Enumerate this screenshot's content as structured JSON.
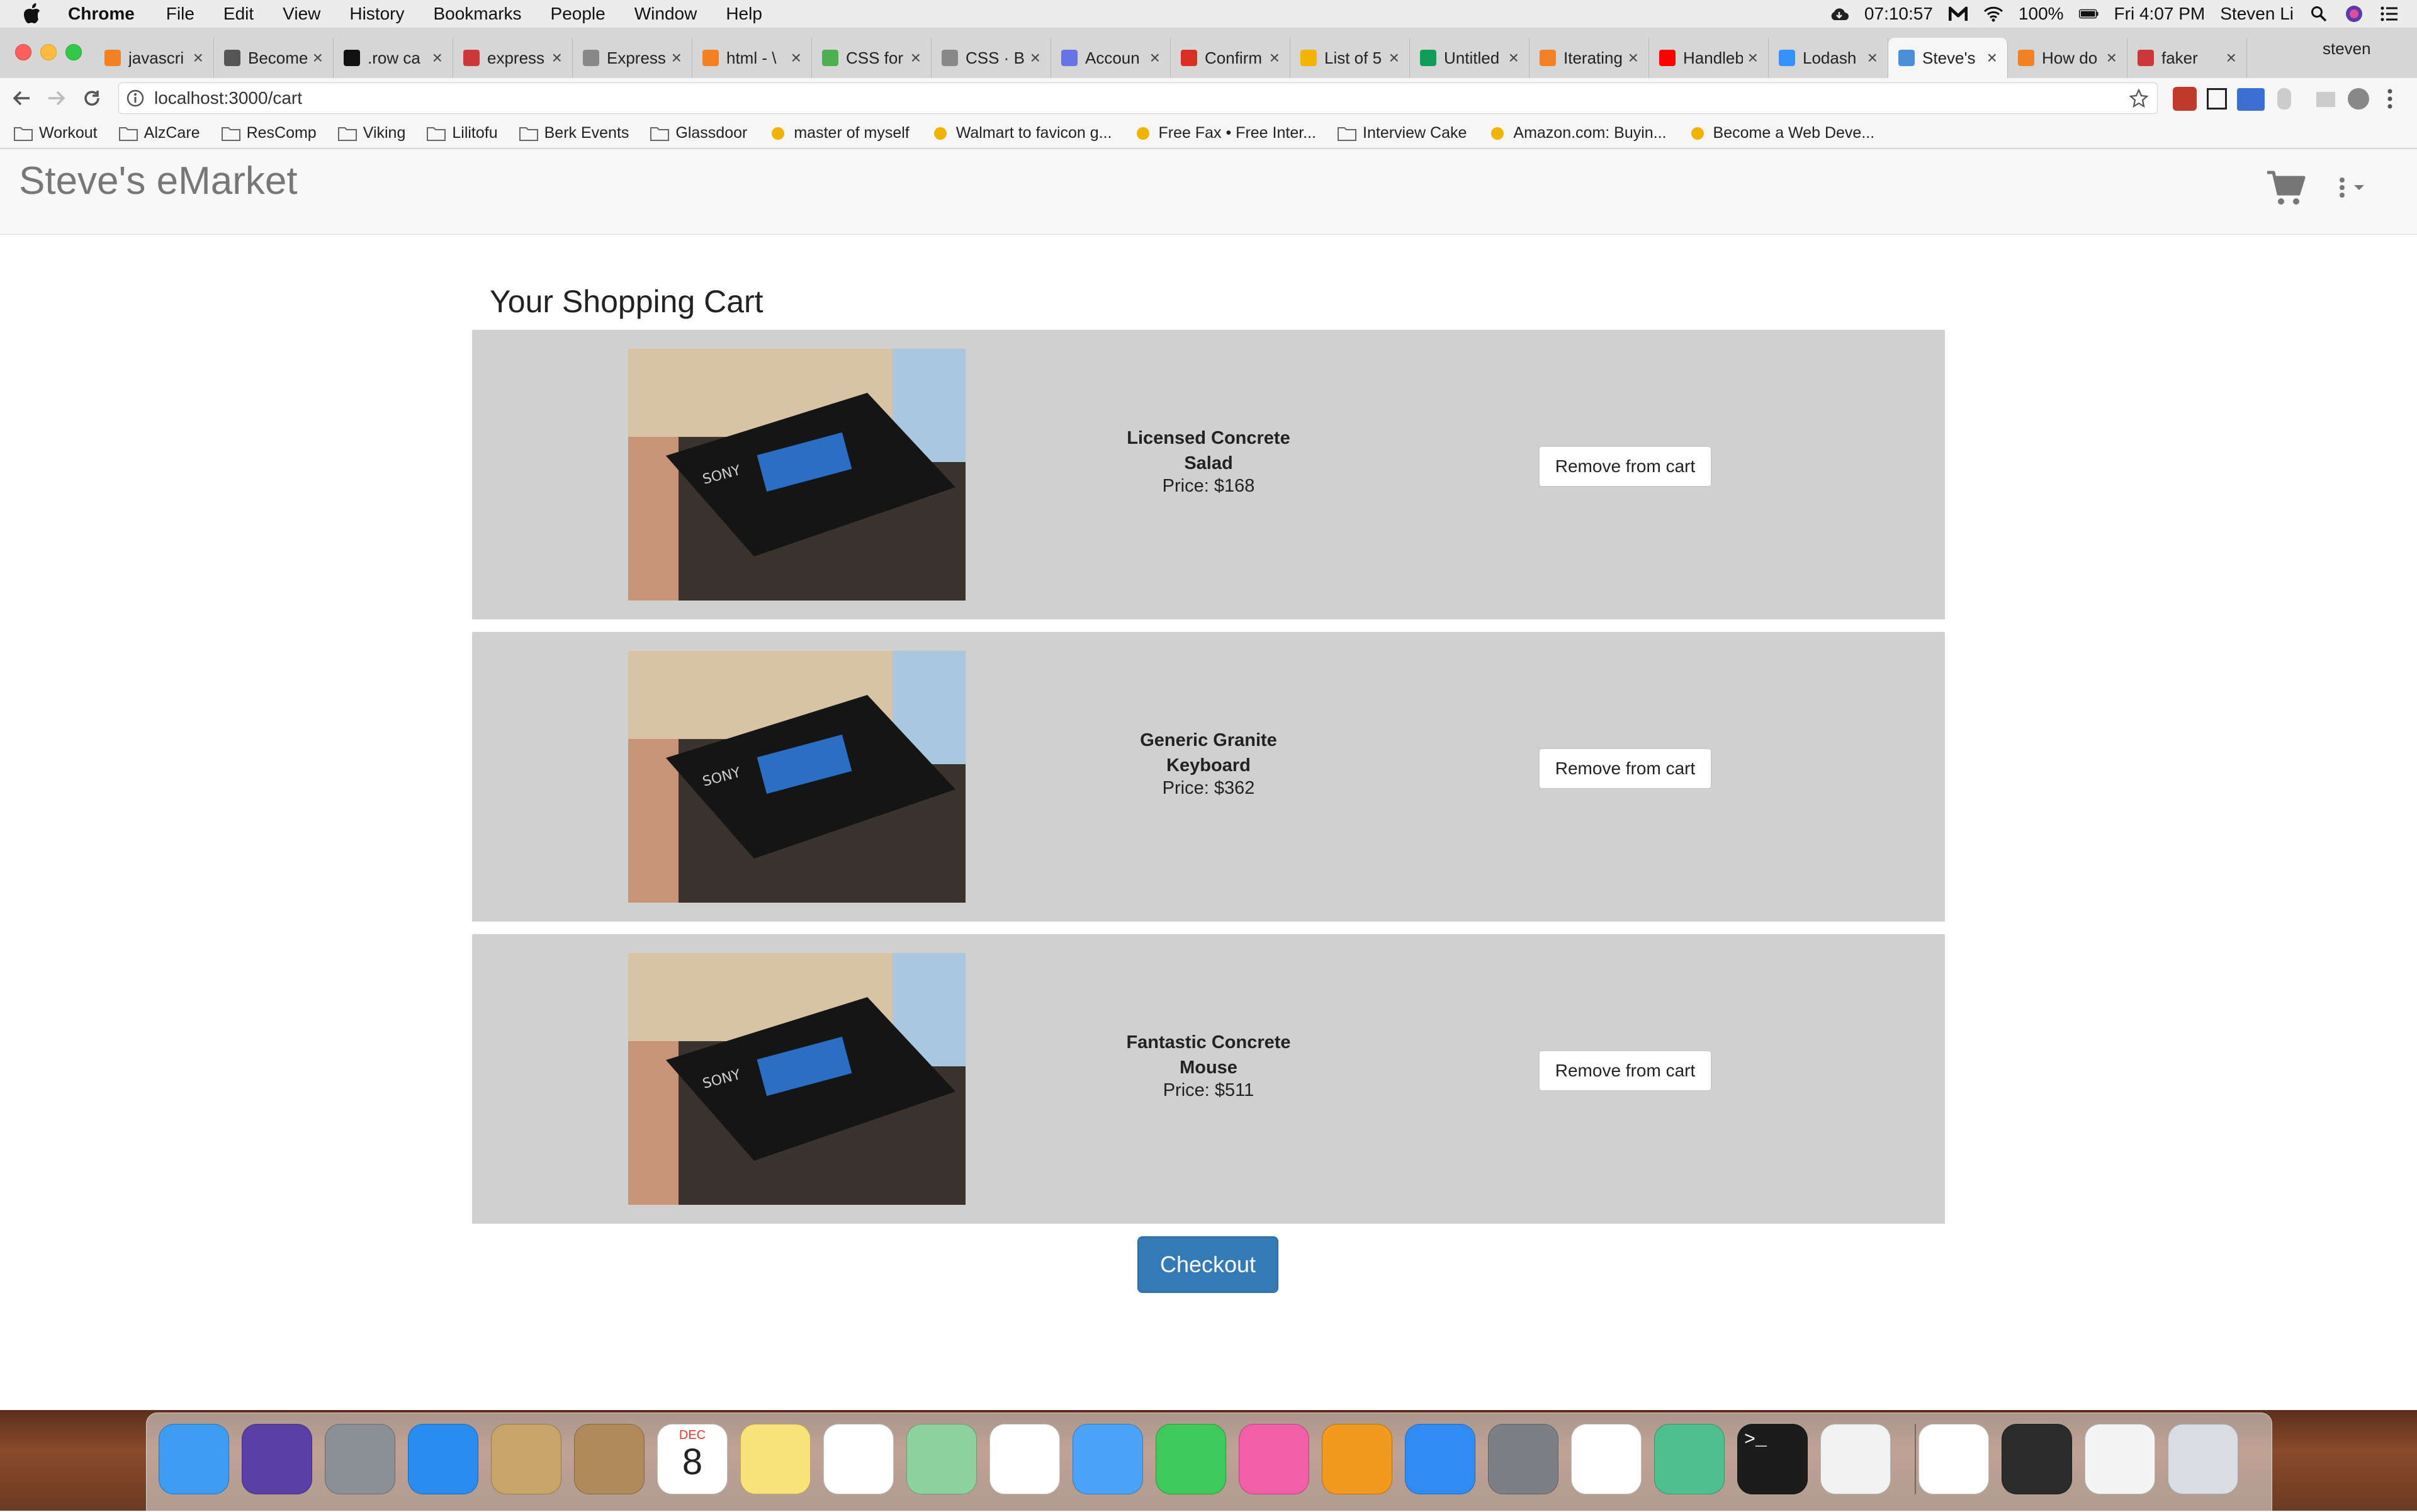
{
  "menubar": {
    "app_name": "Chrome",
    "items": [
      "File",
      "Edit",
      "View",
      "History",
      "Bookmarks",
      "People",
      "Window",
      "Help"
    ],
    "timer": "07:10:57",
    "battery": "100%",
    "datetime": "Fri 4:07 PM",
    "user": "Steven Li"
  },
  "tabs": [
    {
      "label": "javascri",
      "icon": "stackoverflow-icon",
      "color": "#f48024"
    },
    {
      "label": "Become",
      "icon": "site-icon",
      "color": "#555555"
    },
    {
      "label": ".row ca",
      "icon": "github-icon",
      "color": "#111111"
    },
    {
      "label": "express",
      "icon": "npm-icon",
      "color": "#cb3837"
    },
    {
      "label": "Express",
      "icon": "doc-icon",
      "color": "#888888"
    },
    {
      "label": "html - \\",
      "icon": "stackoverflow-icon",
      "color": "#f48024"
    },
    {
      "label": "CSS for",
      "icon": "w3-icon",
      "color": "#4caf50"
    },
    {
      "label": "CSS · B",
      "icon": "doc-icon",
      "color": "#888888"
    },
    {
      "label": "Accoun",
      "icon": "s-icon",
      "color": "#6772e5"
    },
    {
      "label": "Confirm",
      "icon": "gmail-icon",
      "color": "#d93025"
    },
    {
      "label": "List of 5",
      "icon": "bookmark-icon",
      "color": "#f4b400"
    },
    {
      "label": "Untitled",
      "icon": "sheets-icon",
      "color": "#0f9d58"
    },
    {
      "label": "Iterating",
      "icon": "stackoverflow-icon",
      "color": "#f48024"
    },
    {
      "label": "Handleb",
      "icon": "youtube-icon",
      "color": "#ff0000"
    },
    {
      "label": "Lodash",
      "icon": "lodash-icon",
      "color": "#3492ff"
    },
    {
      "label": "Steve's",
      "icon": "loading-icon",
      "color": "#4a90d9"
    },
    {
      "label": "How do",
      "icon": "stackoverflow-icon",
      "color": "#f48024"
    },
    {
      "label": "faker",
      "icon": "npm-icon",
      "color": "#cb3837"
    }
  ],
  "profile_name": "steven",
  "url": "localhost:3000/cart",
  "bookmarks": [
    {
      "label": "Workout",
      "icon": "folder-icon"
    },
    {
      "label": "AlzCare",
      "icon": "folder-icon"
    },
    {
      "label": "ResComp",
      "icon": "folder-icon"
    },
    {
      "label": "Viking",
      "icon": "folder-icon"
    },
    {
      "label": "Lilitofu",
      "icon": "folder-icon"
    },
    {
      "label": "Berk Events",
      "icon": "folder-icon"
    },
    {
      "label": "Glassdoor",
      "icon": "folder-icon"
    },
    {
      "label": "master of myself",
      "icon": "circle-icon"
    },
    {
      "label": "Walmart to favicon g...",
      "icon": "walmart-icon"
    },
    {
      "label": "Free Fax • Free Inter...",
      "icon": "fax-icon"
    },
    {
      "label": "Interview Cake",
      "icon": "folder-icon"
    },
    {
      "label": "Amazon.com: Buyin...",
      "icon": "amazon-icon"
    },
    {
      "label": "Become a Web Deve...",
      "icon": "site-icon"
    }
  ],
  "navbar": {
    "brand": "Steve's eMarket"
  },
  "cart": {
    "title": "Your Shopping Cart",
    "remove_label": "Remove from cart",
    "checkout_label": "Checkout",
    "items": [
      {
        "name_line1": "Licensed Concrete",
        "name_line2": "Salad",
        "price": "Price: $168"
      },
      {
        "name_line1": "Generic Granite",
        "name_line2": "Keyboard",
        "price": "Price: $362"
      },
      {
        "name_line1": "Fantastic Concrete",
        "name_line2": "Mouse",
        "price": "Price: $511"
      }
    ]
  },
  "dock": {
    "calendar_month": "DEC",
    "calendar_day": "8",
    "apps": [
      {
        "name": "finder-icon",
        "color": "#3d9bf2"
      },
      {
        "name": "siri-icon",
        "color": "#5a3fa8"
      },
      {
        "name": "launchpad-icon",
        "color": "#8b8f96"
      },
      {
        "name": "safari-icon",
        "color": "#2b8cf0"
      },
      {
        "name": "mail-icon",
        "color": "#c9a46a"
      },
      {
        "name": "contacts-icon",
        "color": "#b08a5a"
      },
      {
        "name": "calendar-icon",
        "color": "#ffffff"
      },
      {
        "name": "notes-icon",
        "color": "#f8e27a"
      },
      {
        "name": "reminders-icon",
        "color": "#ffffff"
      },
      {
        "name": "maps-icon",
        "color": "#8fd19e"
      },
      {
        "name": "photos-icon",
        "color": "#ffffff"
      },
      {
        "name": "messages-icon",
        "color": "#4aa3f7"
      },
      {
        "name": "facetime-icon",
        "color": "#3ec95b"
      },
      {
        "name": "itunes-icon",
        "color": "#f25ea8"
      },
      {
        "name": "ibooks-icon",
        "color": "#f39a1e"
      },
      {
        "name": "appstore-icon",
        "color": "#2f8cf5"
      },
      {
        "name": "system-preferences-icon",
        "color": "#7d7f84"
      },
      {
        "name": "chrome-icon",
        "color": "#ffffff"
      },
      {
        "name": "atom-icon",
        "color": "#4fc08d"
      },
      {
        "name": "terminal-icon",
        "color": "#1c1c1c"
      },
      {
        "name": "textedit-icon",
        "color": "#f2f2f2"
      },
      {
        "name": "document-txt-icon",
        "color": "#ffffff"
      },
      {
        "name": "screenshot-thumb-icon",
        "color": "#2b2b2b"
      },
      {
        "name": "screenshot-thumb-2-icon",
        "color": "#f4f4f4"
      },
      {
        "name": "trash-icon",
        "color": "#d9dde2"
      }
    ]
  },
  "colors": {
    "primary_button": "#337ab7",
    "cart_row_bg": "#d0d0d0",
    "navbar_bg": "#f8f8f8"
  }
}
